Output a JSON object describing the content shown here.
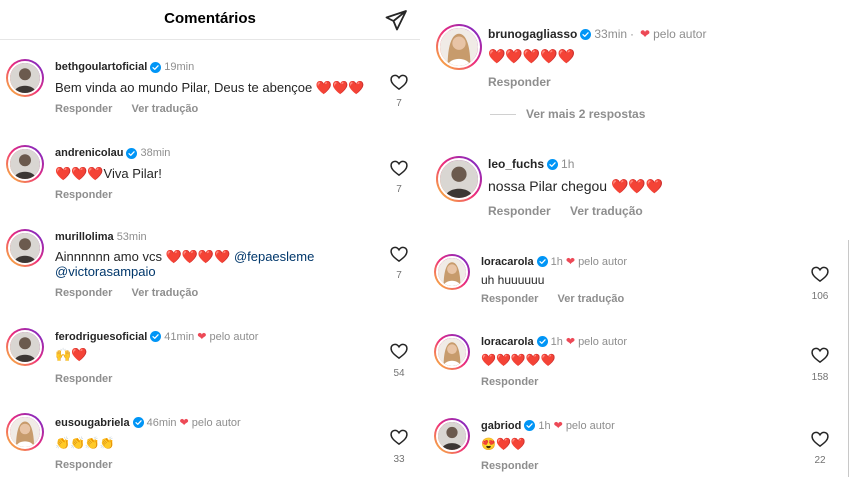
{
  "header": {
    "title": "Comentários"
  },
  "labels": {
    "reply": "Responder",
    "translate": "Ver tradução",
    "by_author": "pelo autor"
  },
  "left_comments": [
    {
      "username": "bethgoulartoficial",
      "time": "19min",
      "text": "Bem vinda ao mundo Pilar, Deus te abençoe ❤️❤️❤️",
      "likes": "7"
    },
    {
      "username": "andrenicolau",
      "time": "38min",
      "text": "❤️❤️❤️Viva Pilar!",
      "likes": "7"
    },
    {
      "username": "murillolima",
      "time": "53min",
      "text_line1": "Ainnnnnn amo vcs ❤️❤️❤️❤️",
      "mention1": "@fepaesleme",
      "mention2": "@victorasampaio",
      "likes": "7"
    },
    {
      "username": "ferodriguesoficial",
      "time": "41min",
      "text": "🙌❤️",
      "likes": "54"
    },
    {
      "username": "eusougabriela",
      "time": "46min",
      "text": "👏👏👏👏",
      "likes": "33"
    }
  ],
  "right_top": [
    {
      "username": "brunogagliasso",
      "time": "33min",
      "text": "❤️❤️❤️❤️❤️"
    },
    {
      "username": "leo_fuchs",
      "time": "1h",
      "text": "nossa Pilar chegou ❤️❤️❤️"
    }
  ],
  "more_replies": "Ver mais 2 respostas",
  "right_bottom": [
    {
      "username": "loracarola",
      "time": "1h",
      "text": "uh huuuuuu",
      "likes": "106"
    },
    {
      "username": "loracarola",
      "time": "1h",
      "text": "❤️❤️❤️❤️❤️",
      "likes": "158"
    },
    {
      "username": "gabriod",
      "time": "1h",
      "text": "😍❤️❤️",
      "likes": "22"
    }
  ],
  "colors": {
    "accent_heart": "#ed4956",
    "verified": "#0095f6",
    "mention": "#00376b"
  }
}
